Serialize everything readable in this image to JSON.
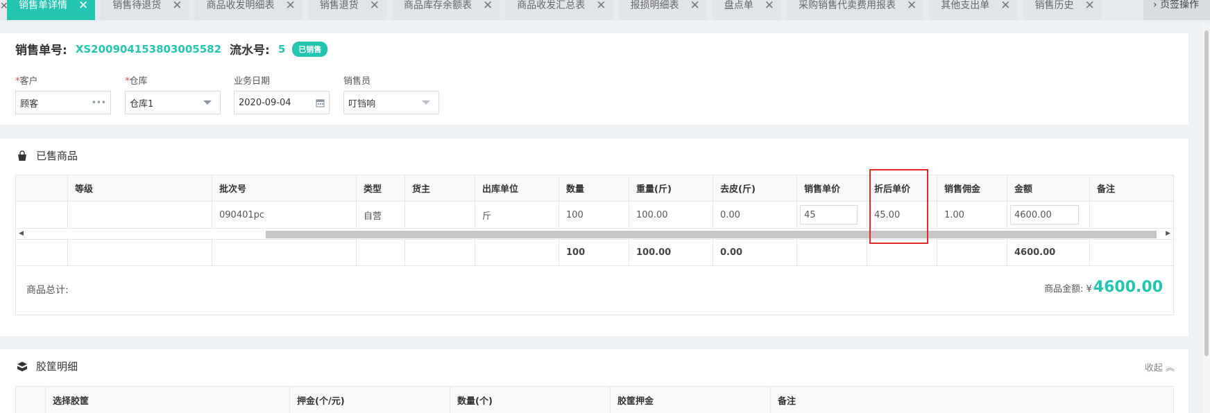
{
  "tabs": [
    {
      "label": "销售单详情",
      "active": true
    },
    {
      "label": "销售待退货"
    },
    {
      "label": "商品收发明细表"
    },
    {
      "label": "销售退货"
    },
    {
      "label": "商品库存余额表"
    },
    {
      "label": "商品收发汇总表"
    },
    {
      "label": "报损明细表"
    },
    {
      "label": "盘点单"
    },
    {
      "label": "采购销售代卖费用报表"
    },
    {
      "label": "其他支出单"
    },
    {
      "label": "销售历史"
    }
  ],
  "tab_close": "✕",
  "tab_ops_label": "页签操作",
  "header": {
    "order_label": "销售单号:",
    "order_no": "XS200904153803005582",
    "serial_label": "流水号:",
    "serial_no": "5",
    "status": "已销售"
  },
  "fields": {
    "customer": {
      "label": "客户",
      "value": "顾客"
    },
    "warehouse": {
      "label": "仓库",
      "value": "仓库1"
    },
    "biz_date": {
      "label": "业务日期",
      "value": "2020-09-04"
    },
    "salesperson": {
      "label": "销售员",
      "value": "叮铛响"
    }
  },
  "required_mark": "*",
  "sold_section": {
    "title": "已售商品",
    "columns": [
      "",
      "等级",
      "批次号",
      "类型",
      "货主",
      "出库单位",
      "数量",
      "重量(斤)",
      "去皮(斤)",
      "销售单价",
      "折后单价",
      "销售佣金",
      "金额",
      "备注"
    ],
    "row": [
      "",
      "",
      "090401pc",
      "自营",
      "",
      "斤",
      "100",
      "100.00",
      "0.00",
      "45",
      "45.00",
      "1.00",
      "4600.00",
      ""
    ],
    "summary": [
      "",
      "",
      "",
      "",
      "",
      "",
      "100",
      "100.00",
      "0.00",
      "",
      "",
      "",
      "4600.00",
      ""
    ],
    "total_label": "商品总计:",
    "amount_label": "商品金额:",
    "currency": "¥",
    "amount": "4600.00"
  },
  "crate_section": {
    "title": "胶筐明细",
    "collapse_label": "收起",
    "columns": [
      "",
      "选择胶筐",
      "押金(个/元)",
      "数量(个)",
      "胶筐押金",
      "备注"
    ]
  },
  "colors": {
    "accent": "#23c4b0",
    "highlight": "#e5262b"
  },
  "icons": [
    "close-icon",
    "more-icon",
    "calendar-icon",
    "basket-icon",
    "box-icon",
    "chevron-up-icon"
  ]
}
